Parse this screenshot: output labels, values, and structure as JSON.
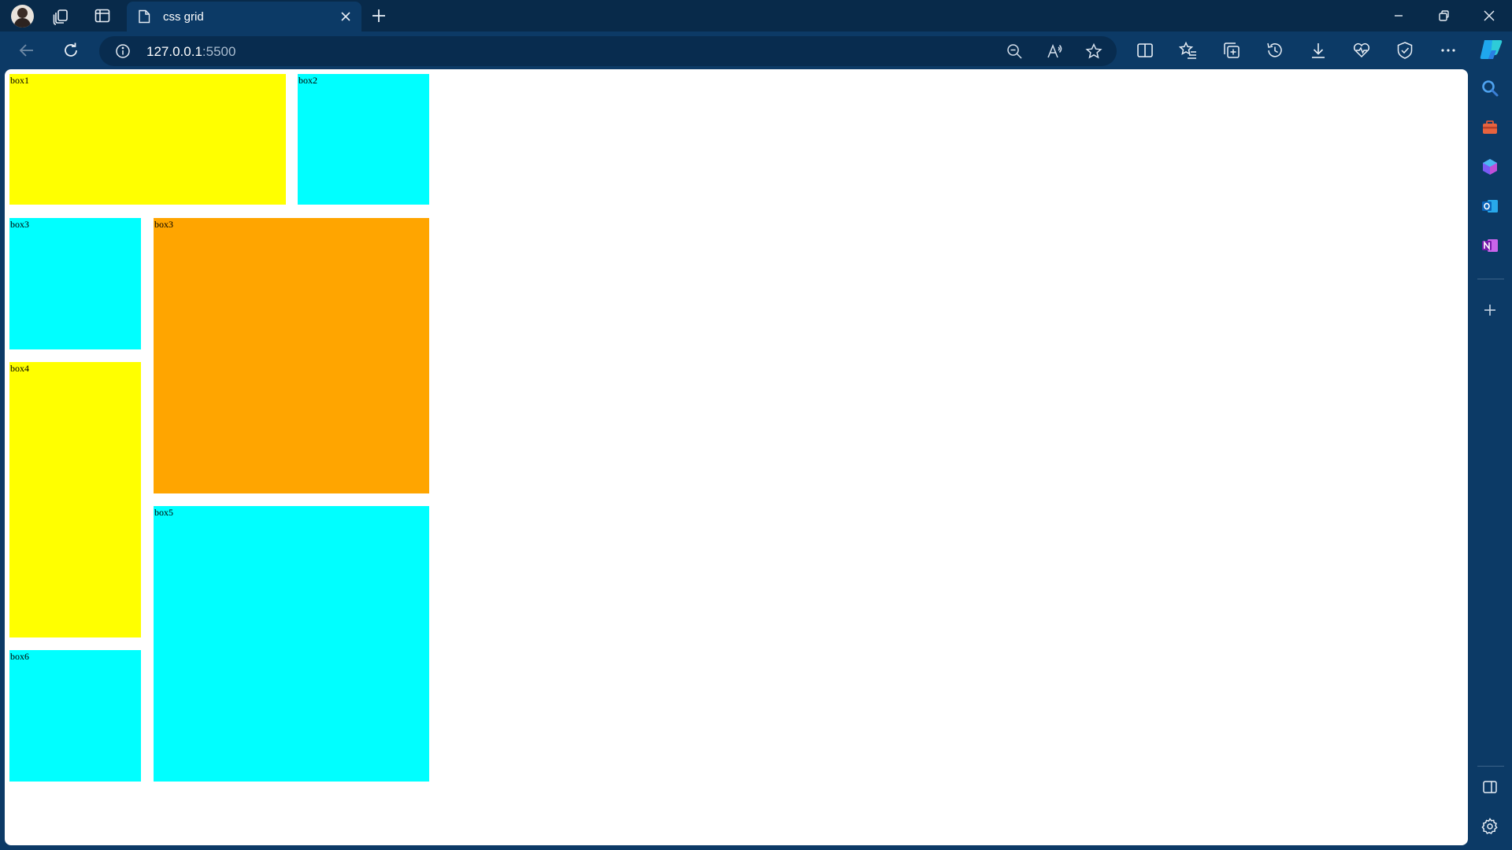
{
  "browser": {
    "tab": {
      "title": "css grid"
    },
    "address": {
      "host": "127.0.0.1",
      "port": ":5500"
    }
  },
  "page": {
    "boxes": [
      {
        "label": "box1",
        "color": "#ffff00"
      },
      {
        "label": "box2",
        "color": "#00ffff"
      },
      {
        "label": "box3",
        "color": "#00ffff"
      },
      {
        "label": "box3",
        "color": "#ffa500"
      },
      {
        "label": "box4",
        "color": "#ffff00"
      },
      {
        "label": "box5",
        "color": "#00ffff"
      },
      {
        "label": "box6",
        "color": "#00ffff"
      }
    ]
  },
  "icons": {
    "titlebar": [
      "profile-avatar",
      "workspaces-icon",
      "tab-actions-icon",
      "document-icon",
      "close-icon",
      "plus-icon",
      "minimize-icon",
      "restore-icon",
      "close-window-icon"
    ],
    "toolbar": [
      "back-icon",
      "refresh-icon",
      "info-icon",
      "zoom-out-icon",
      "read-aloud-icon",
      "favorite-star-icon",
      "split-screen-icon",
      "favorites-icon",
      "collections-icon",
      "history-icon",
      "download-icon",
      "performance-icon",
      "browser-essentials-icon",
      "more-icon",
      "copilot-icon"
    ],
    "sidebar": [
      "search-icon",
      "tools-icon",
      "copilot-sidebar-icon",
      "outlook-icon",
      "onenote-icon",
      "add-icon",
      "sidebar-toggle-icon",
      "settings-icon"
    ]
  }
}
